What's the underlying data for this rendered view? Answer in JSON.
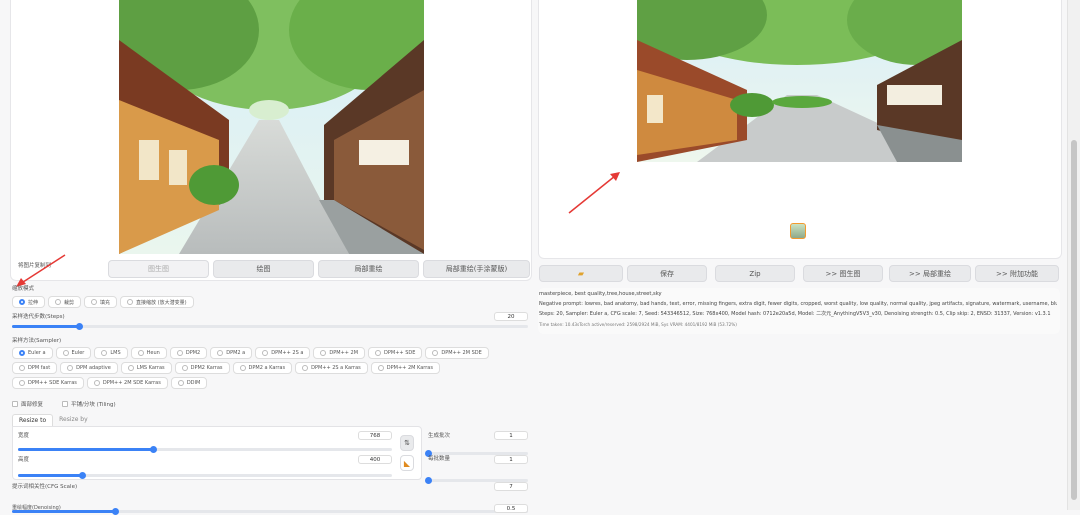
{
  "left": {
    "send_to_label": "将图片复制到",
    "buttons": [
      "图生图",
      "绘图",
      "局部重绘",
      "局部重绘(手涂蒙版)"
    ],
    "resize_mode": {
      "label": "缩放模式",
      "options": [
        "拉伸",
        "裁剪",
        "填充",
        "直接缩放 (放大潜变量)"
      ],
      "selected": 0
    },
    "steps": {
      "label": "采样迭代步数(Steps)",
      "value": "20",
      "fraction": 0.13
    },
    "sampler": {
      "label": "采样方法(Sampler)",
      "options": [
        "Euler a",
        "Euler",
        "LMS",
        "Heun",
        "DPM2",
        "DPM2 a",
        "DPM++ 2S a",
        "DPM++ 2M",
        "DPM++ SDE",
        "DPM++ 2M SDE",
        "DPM fast",
        "DPM adaptive",
        "LMS Karras",
        "DPM2 Karras",
        "DPM2 a Karras",
        "DPM++ 2S a Karras",
        "DPM++ 2M Karras",
        "DPM++ SDE Karras",
        "DPM++ 2M SDE Karras",
        "DDIM"
      ],
      "selected": 0
    },
    "checkboxes": [
      "面部修复",
      "平铺/分块 (Tiling)"
    ],
    "tabs": [
      "Resize to",
      "Resize by"
    ],
    "width": {
      "label": "宽度",
      "value": "768",
      "fraction": 0.36
    },
    "height": {
      "label": "高度",
      "value": "400",
      "fraction": 0.17
    },
    "batch_count": {
      "label": "生成批次",
      "value": "1",
      "fraction": 0.0
    },
    "batch_size": {
      "label": "每批数量",
      "value": "1",
      "fraction": 0.0
    },
    "cfg": {
      "label": "提示词相关性(CFG Scale)",
      "value": "7",
      "fraction": 0.2
    },
    "denoise": {
      "label": "重绘幅度(Denoising)",
      "value": "0.5"
    },
    "swap_icon": "swap-arrows-icon",
    "ruler_icon": "triangle-ruler-icon"
  },
  "right": {
    "buttons": [
      "",
      "保存",
      "Zip",
      ">> 图生图",
      ">> 局部重绘",
      ">> 附加功能"
    ],
    "folder_icon": "folder-icon",
    "info_lines": [
      "masterpiece, best quality,tree,house,street,sky",
      "Negative prompt: lowres, bad anatomy, bad hands, text, error, missing fingers, extra digit, fewer digits, cropped, worst quality, low quality, normal quality, jpeg artifacts, signature, watermark, username, blurry",
      "Steps: 20, Sampler: Euler a, CFG scale: 7, Seed: 543346512, Size: 768x400, Model hash: 0712e20a5d, Model: 二次元_AnythingV5V3_v30, Denoising strength: 0.5, Clip skip: 2, ENSD: 31337, Version: v1.3.1"
    ],
    "time_line": "Time taken: 10.43sTorch active/reserved: 2598/2924 MiB, Sys VRAM: 4401/8192 MiB (53.72%)"
  },
  "colors": {
    "accent": "#3b82f6",
    "arrow": "#e53935"
  }
}
